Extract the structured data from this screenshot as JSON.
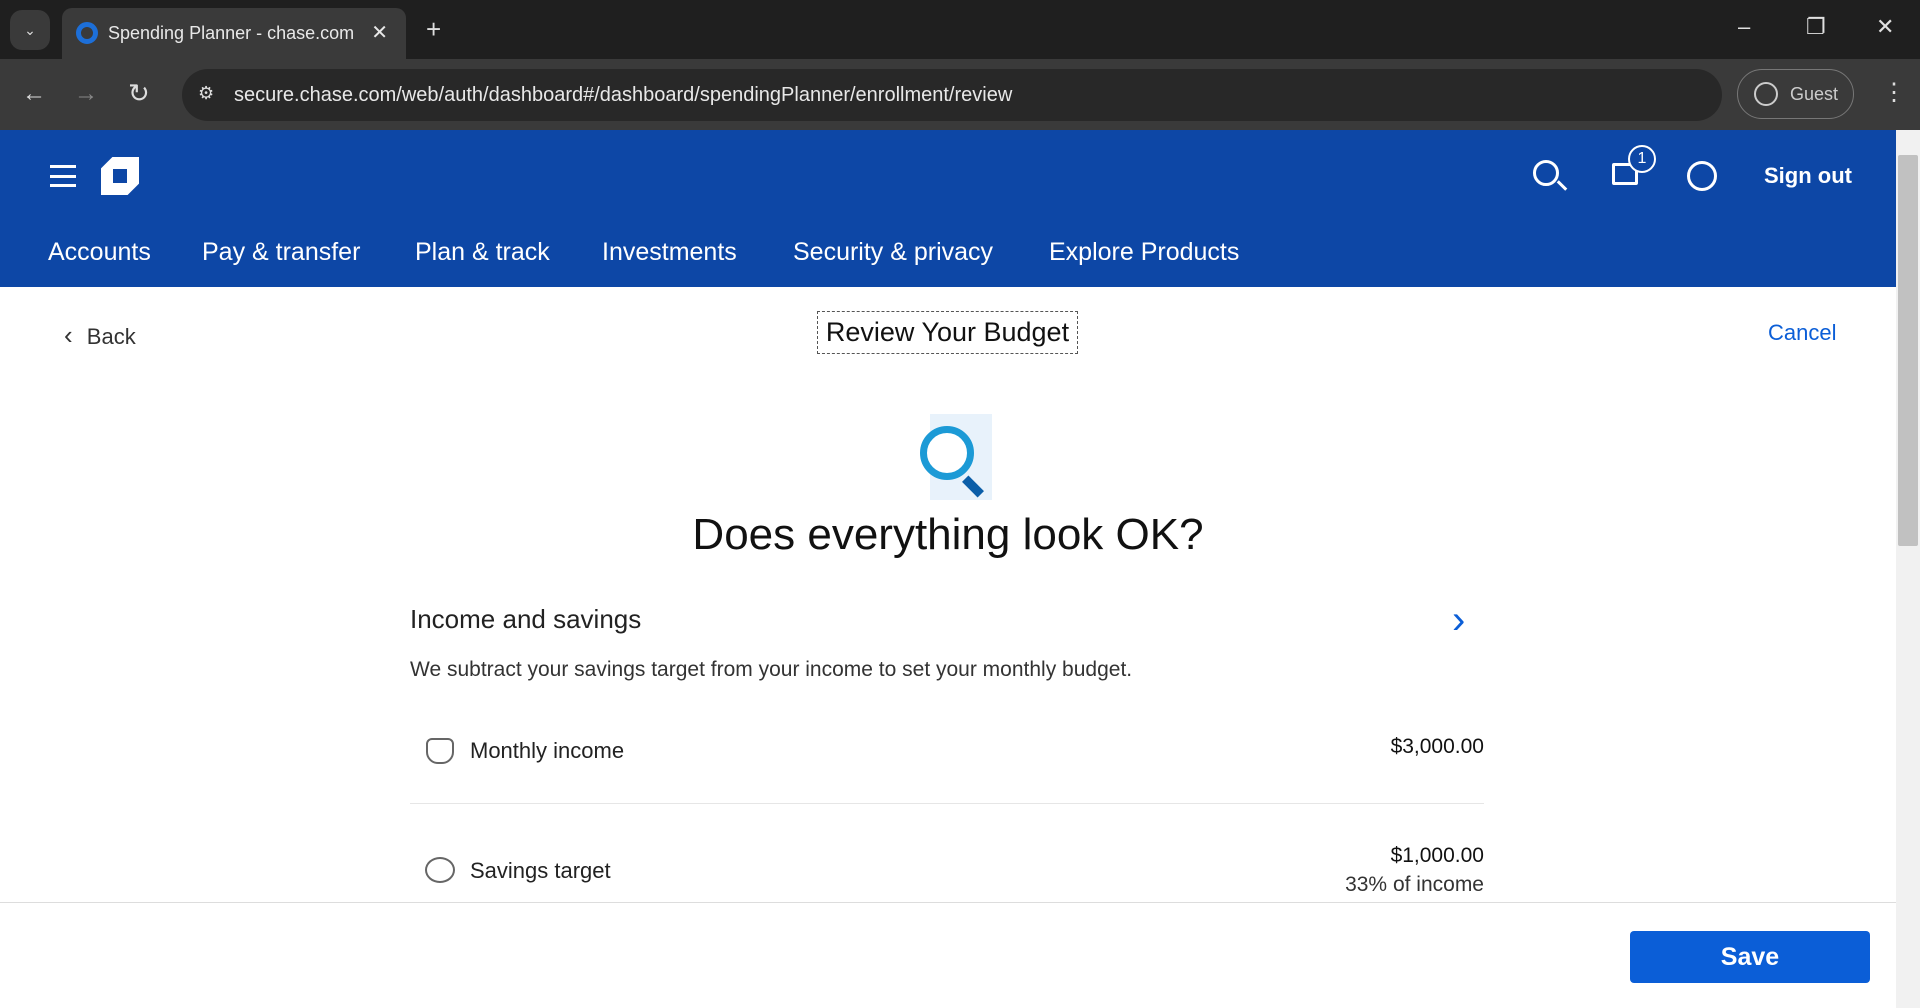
{
  "browser": {
    "tab_title": "Spending Planner - chase.com",
    "url": "secure.chase.com/web/auth/dashboard#/dashboard/spendingPlanner/enrollment/review",
    "profile": "Guest"
  },
  "header": {
    "notification_count": "1",
    "sign_out": "Sign out",
    "nav": [
      "Accounts",
      "Pay & transfer",
      "Plan & track",
      "Investments",
      "Security & privacy",
      "Explore Products"
    ]
  },
  "page": {
    "back": "Back",
    "title": "Review Your Budget",
    "cancel": "Cancel",
    "heading": "Does everything look OK?",
    "section": {
      "title": "Income and savings",
      "description": "We subtract your savings target from your income to set your monthly budget.",
      "rows": [
        {
          "label": "Monthly income",
          "amount": "$3,000.00",
          "icon": "money-stack-icon"
        },
        {
          "label": "Savings target",
          "amount": "$1,000.00",
          "sub": "33% of income",
          "icon": "piggy-bank-icon"
        }
      ]
    }
  },
  "footer": {
    "save": "Save"
  },
  "colors": {
    "brand": "#0d47a6",
    "accent": "#0b5ed7"
  }
}
